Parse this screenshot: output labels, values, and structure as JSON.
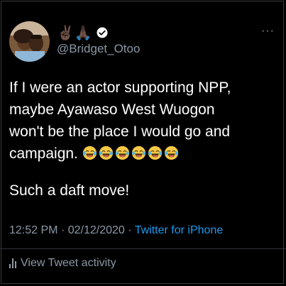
{
  "profile": {
    "name_emojis": "✌🏿🙏🏿",
    "handle": "@Bridget_Otoo",
    "verified": true
  },
  "tweet": {
    "lines": [
      "If I were an actor supporting NPP,",
      "maybe Ayawaso West Wuogon",
      "won't be the place I would go and",
      "campaign."
    ],
    "emoji_name": "face-with-tears-of-joy",
    "emoji_count": 6,
    "second_paragraph": "Such a daft move!"
  },
  "meta": {
    "time": "12:52 PM",
    "date": "02/12/2020",
    "separator": "·",
    "source": "Twitter for iPhone"
  },
  "activity": {
    "label": "View Tweet activity"
  },
  "more_icon": "···",
  "colors": {
    "background": "#000000",
    "text": "#ffffff",
    "muted": "#8b98a5",
    "link": "#1d9bf0"
  }
}
